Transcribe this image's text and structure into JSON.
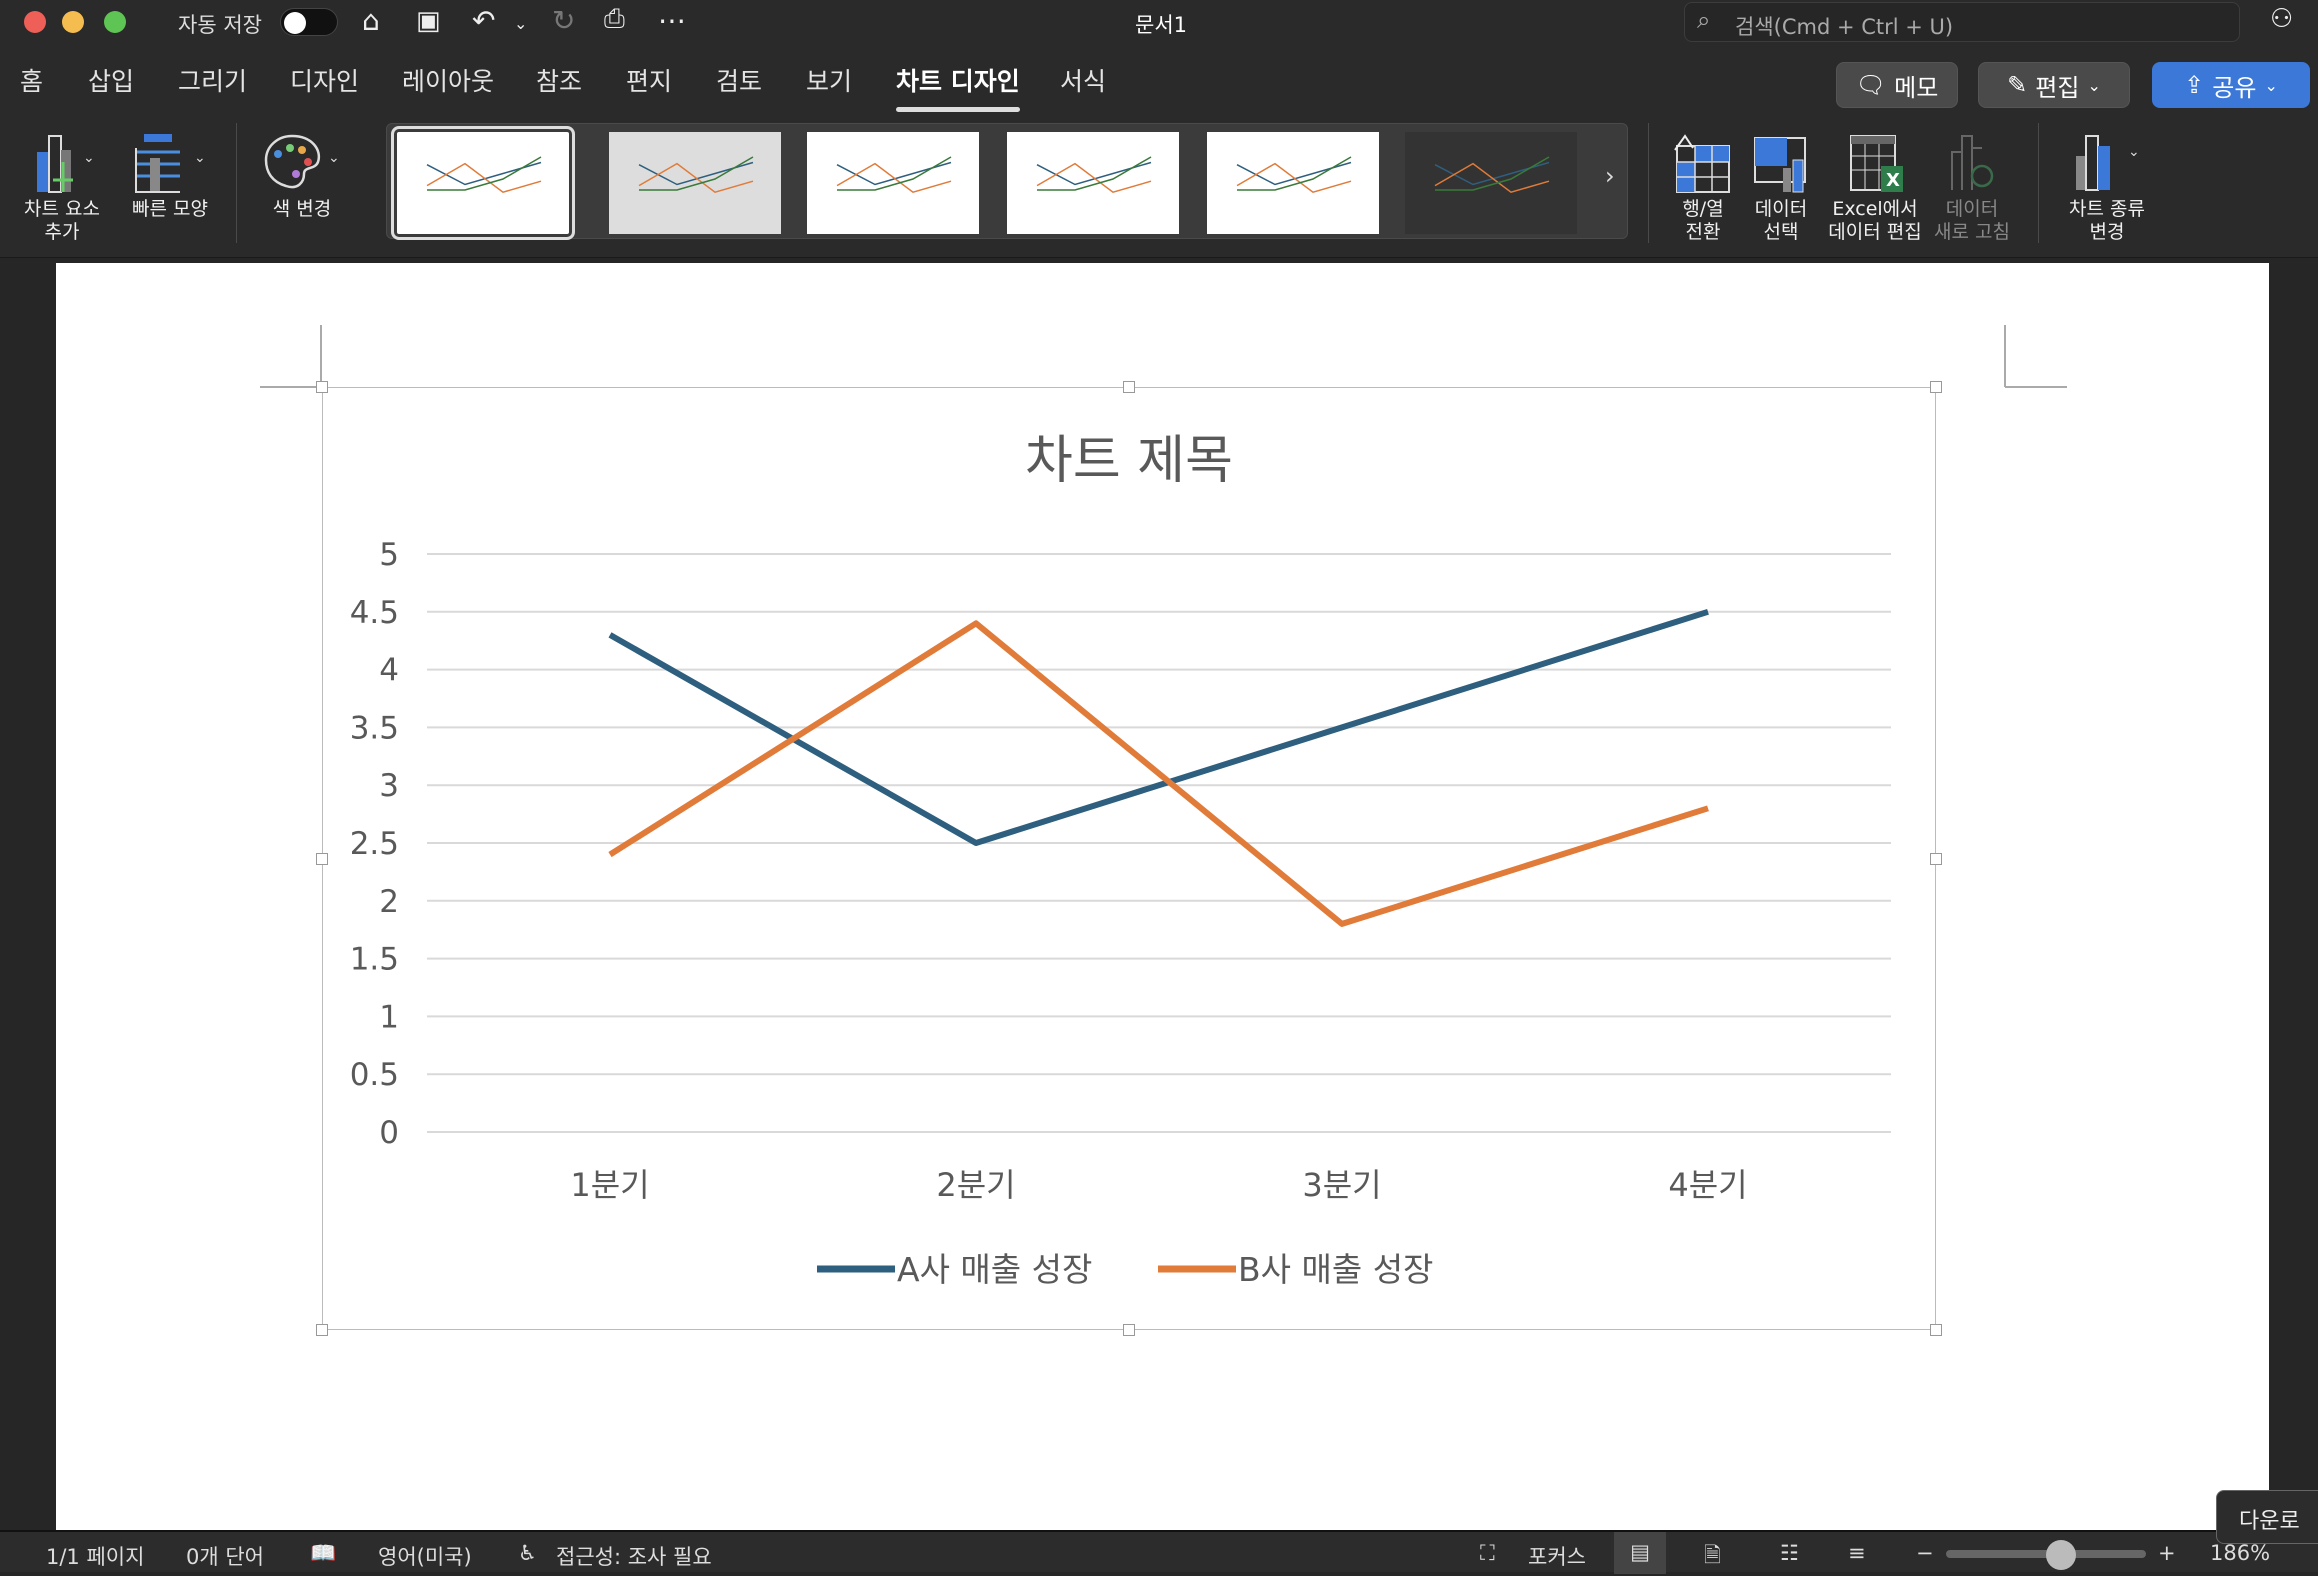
{
  "window": {
    "title": "문서1",
    "autosave_label": "자동 저장",
    "autosave_on": false,
    "search_placeholder": "검색(Cmd + Ctrl + U)"
  },
  "tabs": [
    {
      "label": "홈"
    },
    {
      "label": "삽입"
    },
    {
      "label": "그리기"
    },
    {
      "label": "디자인"
    },
    {
      "label": "레이아웃"
    },
    {
      "label": "참조"
    },
    {
      "label": "편지"
    },
    {
      "label": "검토"
    },
    {
      "label": "보기"
    },
    {
      "label": "차트 디자인",
      "active": true
    },
    {
      "label": "서식"
    }
  ],
  "actions": {
    "memo": "메모",
    "edit": "편집",
    "share": "공유"
  },
  "ribbon": {
    "add_element": [
      "차트 요소",
      "추가"
    ],
    "quick_layout": "빠른 모양",
    "change_color": "색 변경",
    "switch_row_col": [
      "행/열",
      "전환"
    ],
    "select_data": [
      "데이터",
      "선택"
    ],
    "edit_in_excel": [
      "Excel에서",
      "데이터 편집"
    ],
    "refresh_data": [
      "데이터",
      "새로 고침"
    ],
    "change_type": [
      "차트 종류",
      "변경"
    ],
    "style_count": 6,
    "selected_style": 1
  },
  "chart_data": {
    "type": "line",
    "title": "차트 제목",
    "categories": [
      "1분기",
      "2분기",
      "3분기",
      "4분기"
    ],
    "series": [
      {
        "name": "A사 매출 성장",
        "values": [
          4.3,
          2.5,
          3.5,
          4.5
        ],
        "color": "#2E5F7F"
      },
      {
        "name": "B사 매출 성장",
        "values": [
          2.4,
          4.4,
          1.8,
          2.8
        ],
        "color": "#E07B39"
      }
    ],
    "ylim": [
      0,
      5
    ],
    "yticks": [
      "0",
      "0.5",
      "1",
      "1.5",
      "2",
      "2.5",
      "3",
      "3.5",
      "4",
      "4.5",
      "5"
    ],
    "grid": true,
    "legend": "bottom"
  },
  "status": {
    "page": "1/1 페이지",
    "words": "0개 단어",
    "language": "영어(미국)",
    "accessibility": "접근성: 조사 필요",
    "focus": "포커스",
    "zoom": "186%",
    "tooltip": "다운로"
  }
}
